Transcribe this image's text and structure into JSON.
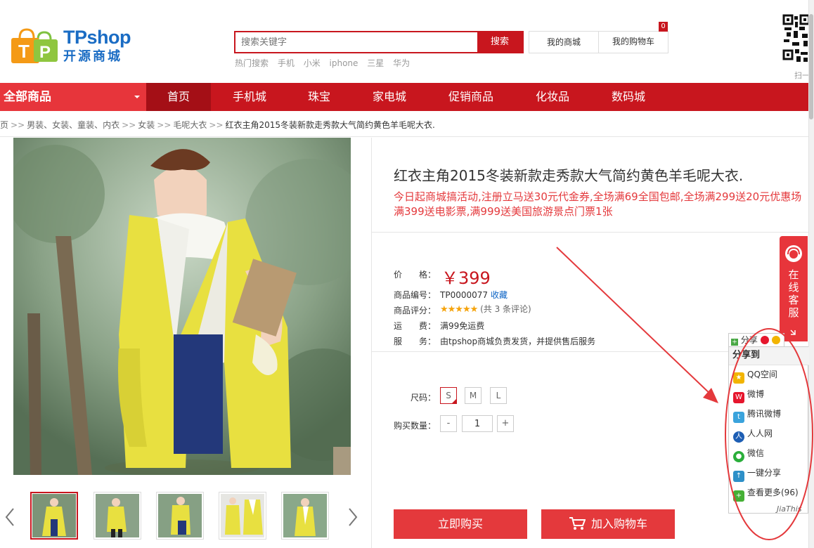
{
  "header": {
    "logo_en": "TPshop",
    "logo_cn": "开源商城",
    "search_placeholder": "搜索关键字",
    "search_button": "搜索",
    "hot_label": "热门搜索",
    "hot_keywords": [
      "手机",
      "小米",
      "iphone",
      "三星",
      "华为"
    ],
    "my_mall": "我的商城",
    "my_cart": "我的购物车",
    "cart_count": "0",
    "qr_caption": "扫一"
  },
  "nav": {
    "all_categories": "全部商品",
    "items": [
      "首页",
      "手机城",
      "珠宝",
      "家电城",
      "促销商品",
      "化妆品",
      "数码城"
    ]
  },
  "breadcrumb": {
    "items": [
      "页",
      "男装、女装、童装、内衣",
      "女装",
      "毛呢大衣",
      "红衣主角2015冬装新款走秀款大气简约黄色羊毛呢大衣."
    ],
    "separator": ">>"
  },
  "product": {
    "title": "红衣主角2015冬装新款走秀款大气简约黄色羊毛呢大衣.",
    "promo": "今日起商城搞活动,注册立马送30元代金券,全场满69全国包邮,全场满299送20元优惠场满399送电影票,满999送美国旅游景点门票1张",
    "price_label": "价　　格：",
    "price": "￥399",
    "sku_label": "商品编号：",
    "sku": "TP0000077",
    "favorite": "收藏",
    "rating_label": "商品评分：",
    "rating": 5,
    "stars": "★★★★★",
    "reviews": "(共 3 条评论)",
    "shipping_label": "运　　费：",
    "shipping": "满99免运费",
    "service_label": "服　　务：",
    "service": "由tpshop商城负责发货，并提供售后服务",
    "size_label": "尺码：",
    "sizes": [
      "S",
      "M",
      "L"
    ],
    "selected_size": "S",
    "qty_label": "购买数量：",
    "qty_minus": "-",
    "qty": "1",
    "qty_plus": "+",
    "buy_now": "立即购买",
    "add_to_cart": "加入购物车"
  },
  "thumbnails": [
    "thumb-1",
    "thumb-2",
    "thumb-3",
    "thumb-4",
    "thumb-5"
  ],
  "side": {
    "customer_service": "在线客服",
    "share_head": "分享",
    "share_title": "分享到",
    "share_items": [
      {
        "label": "QQ空间",
        "color": "#f2b400"
      },
      {
        "label": "微博",
        "color": "#e6162d"
      },
      {
        "label": "腾讯微博",
        "color": "#3aa3dc"
      },
      {
        "label": "人人网",
        "color": "#1d5eb4"
      },
      {
        "label": "微信",
        "color": "#2aae3a"
      },
      {
        "label": "一键分享",
        "color": "#2e90c8"
      },
      {
        "label": "查看更多(96)",
        "color": "#45b035"
      }
    ],
    "share_footer": "JiaThis"
  },
  "colors": {
    "brand_red": "#c8161e",
    "nav_home": "#a40f16",
    "promo_red": "#e4393c",
    "logo_blue": "#1a6cc4"
  }
}
